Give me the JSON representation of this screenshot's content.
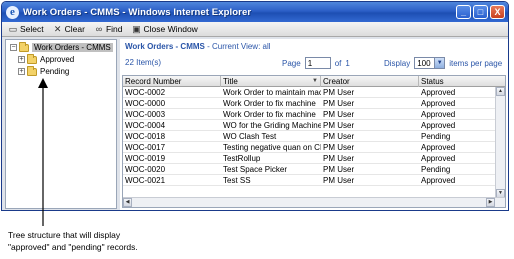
{
  "window": {
    "title": "Work Orders - CMMS - Windows Internet Explorer",
    "buttons": {
      "minimize": "_",
      "maximize": "□",
      "close": "X"
    },
    "colors": {
      "titlebar": "#2c5fc7",
      "accent": "#2a55a8"
    }
  },
  "toolbar": {
    "items": [
      {
        "label": "Select",
        "icon": "select-folder-icon"
      },
      {
        "label": "Clear",
        "icon": "clear-x-icon"
      },
      {
        "label": "Find",
        "icon": "binoculars-icon"
      },
      {
        "label": "Close Window",
        "icon": "close-window-icon"
      }
    ]
  },
  "tree": {
    "root": {
      "label": "Work Orders - CMMS",
      "expander": "⊟"
    },
    "children": [
      {
        "label": "Approved",
        "expander": "+"
      },
      {
        "label": "Pending",
        "expander": "+"
      }
    ]
  },
  "breadcrumb": {
    "main": "Work Orders - CMMS",
    "separator": " - ",
    "view_label": "Current View:",
    "view_value": "all"
  },
  "items_count": "22 Item(s)",
  "pager": {
    "page_label": "Page",
    "page_value": "1",
    "of_label": "of",
    "total_pages": "1"
  },
  "display": {
    "label": "Display",
    "value": "100",
    "suffix": "items per page"
  },
  "grid": {
    "columns": [
      "Record Number",
      "Title",
      "Creator",
      "Status"
    ],
    "rows": [
      [
        "WOC-0002",
        "Work Order to maintain machine",
        "PM User",
        "Approved"
      ],
      [
        "WOC-0000",
        "Work Order to fix machine",
        "PM User",
        "Approved"
      ],
      [
        "WOC-0003",
        "Work Order to fix machine",
        "PM User",
        "Approved"
      ],
      [
        "WOC-0004",
        "WO for the Griding Machine",
        "PM User",
        "Approved"
      ],
      [
        "WOC-0018",
        "WO Clash Test",
        "PM User",
        "Pending"
      ],
      [
        "WOC-0017",
        "Testing negative quan on CMMS",
        "PM User",
        "Approved"
      ],
      [
        "WOC-0019",
        "TestRollup",
        "PM User",
        "Approved"
      ],
      [
        "WOC-0020",
        "Test Space Picker",
        "PM User",
        "Pending"
      ],
      [
        "WOC-0021",
        "Test SS",
        "PM User",
        "Approved"
      ]
    ]
  },
  "annotation": {
    "line1": "Tree structure that will display",
    "line2": "\"approved\" and \"pending\" records."
  }
}
